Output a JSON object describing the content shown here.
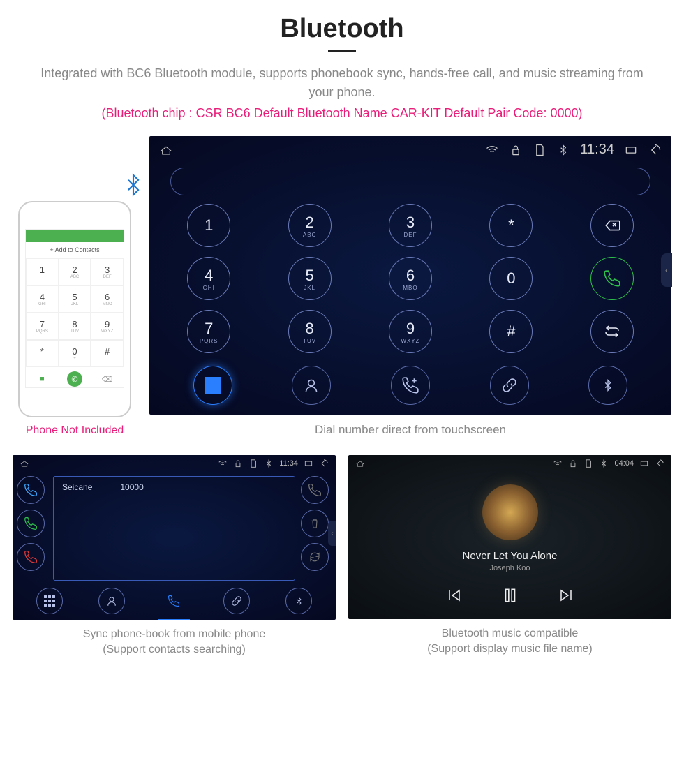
{
  "header": {
    "title": "Bluetooth",
    "description": "Integrated with BC6 Bluetooth module, supports phonebook sync, hands-free call, and music streaming from your phone.",
    "pink_note": "(Bluetooth chip : CSR BC6    Default Bluetooth Name CAR-KIT    Default Pair Code: 0000)"
  },
  "phone": {
    "header": "",
    "add_contacts": "+  Add to Contacts",
    "caption": "Phone Not Included",
    "keys": [
      {
        "n": "1",
        "l": ""
      },
      {
        "n": "2",
        "l": "ABC"
      },
      {
        "n": "3",
        "l": "DEF"
      },
      {
        "n": "4",
        "l": "GHI"
      },
      {
        "n": "5",
        "l": "JKL"
      },
      {
        "n": "6",
        "l": "MNO"
      },
      {
        "n": "7",
        "l": "PQRS"
      },
      {
        "n": "8",
        "l": "TUV"
      },
      {
        "n": "9",
        "l": "WXYZ"
      },
      {
        "n": "*",
        "l": ""
      },
      {
        "n": "0",
        "l": "+"
      },
      {
        "n": "#",
        "l": ""
      }
    ]
  },
  "dialer": {
    "time": "11:34",
    "keys": [
      {
        "n": "1",
        "l": ""
      },
      {
        "n": "2",
        "l": "ABC"
      },
      {
        "n": "3",
        "l": "DEF"
      },
      {
        "n": "*",
        "l": ""
      },
      {
        "n": "⌫",
        "l": "",
        "bs": true
      },
      {
        "n": "4",
        "l": "GHI"
      },
      {
        "n": "5",
        "l": "JKL"
      },
      {
        "n": "6",
        "l": "MBO"
      },
      {
        "n": "0",
        "l": ""
      },
      {
        "n": "call",
        "l": "",
        "call": true
      },
      {
        "n": "7",
        "l": "PQRS"
      },
      {
        "n": "8",
        "l": "TUV"
      },
      {
        "n": "9",
        "l": "WXYZ"
      },
      {
        "n": "#",
        "l": ""
      },
      {
        "n": "swap",
        "l": "",
        "swap": true
      }
    ],
    "caption": "Dial number direct from touchscreen"
  },
  "phonebook": {
    "time": "11:34",
    "contact_name": "Seicane",
    "contact_num": "10000",
    "caption_l1": "Sync phone-book from mobile phone",
    "caption_l2": "(Support contacts searching)"
  },
  "music": {
    "time": "04:04",
    "song": "Never Let You Alone",
    "artist": "Joseph Koo",
    "caption_l1": "Bluetooth music compatible",
    "caption_l2": "(Support display music file name)"
  }
}
